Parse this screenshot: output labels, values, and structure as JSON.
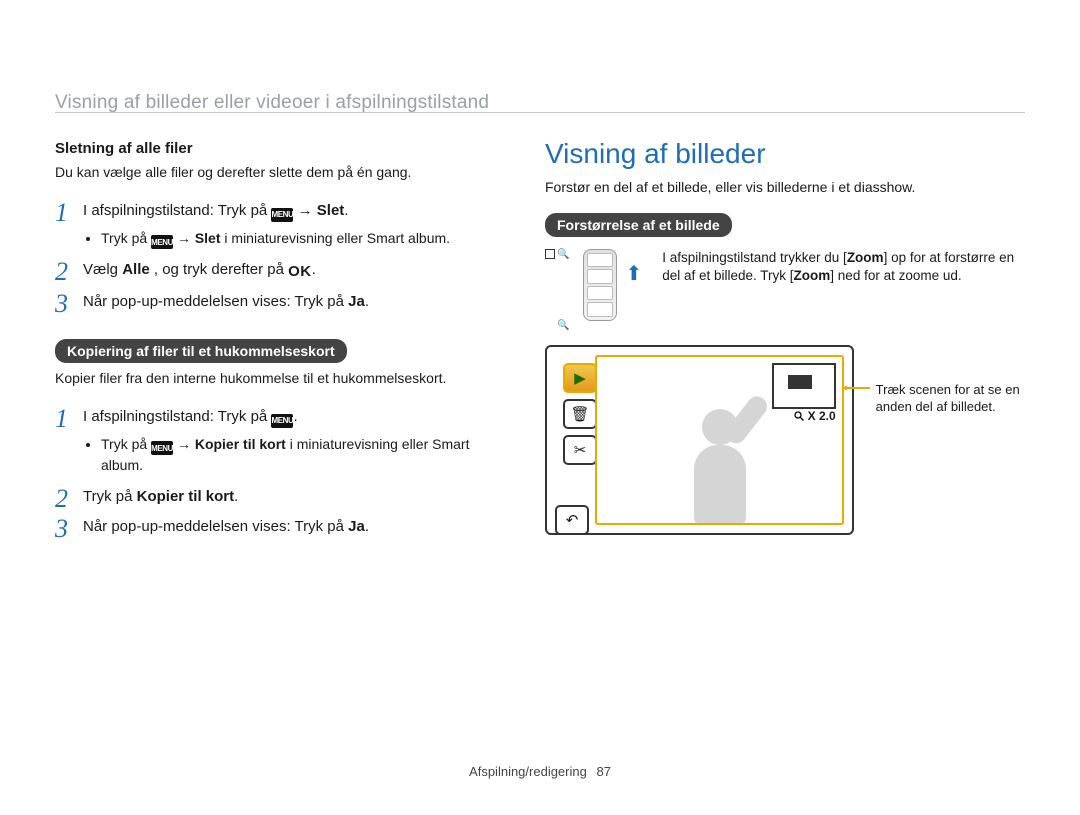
{
  "headerTitle": "Visning af billeder eller videoer i afspilningstilstand",
  "left": {
    "deleteHeading": "Sletning af alle filer",
    "deleteIntro": "Du kan vælge alle filer og derefter slette dem på én gang.",
    "deleteSteps": {
      "s1a": "I afspilningstilstand: Tryk på ",
      "s1b": " → ",
      "s1c": "Slet",
      "s1d": ".",
      "s1bullet_a": "Tryk på ",
      "s1bullet_b": " → ",
      "s1bullet_c": "Slet",
      "s1bullet_d": " i miniaturevisning eller Smart album.",
      "s2a": "Vælg ",
      "s2b": "Alle",
      "s2c": ", og tryk derefter på ",
      "s2ok": "OK",
      "s2d": ".",
      "s3a": "Når pop-up-meddelelsen vises: Tryk på ",
      "s3b": "Ja",
      "s3c": "."
    },
    "copyPill": "Kopiering af filer til et hukommelseskort",
    "copyIntro": "Kopier filer fra den interne hukommelse til et hukommelseskort.",
    "copySteps": {
      "s1a": "I afspilningstilstand: Tryk på ",
      "s1b": ".",
      "s1bullet_a": "Tryk på ",
      "s1bullet_b": " → ",
      "s1bullet_c": "Kopier til kort",
      "s1bullet_d": " i miniaturevisning eller Smart album.",
      "s2a": "Tryk på ",
      "s2b": "Kopier til kort",
      "s2c": ".",
      "s3a": "Når pop-up-meddelelsen vises: Tryk på ",
      "s3b": "Ja",
      "s3c": "."
    }
  },
  "right": {
    "title": "Visning af billeder",
    "intro": "Forstør en del af et billede, eller vis billederne i et diasshow.",
    "zoomPill": "Forstørrelse af et billede",
    "zoomDesc_a": "I afspilningstilstand trykker du [",
    "zoomDesc_b": "Zoom",
    "zoomDesc_c": "] op for at forstørre en del af et billede. Tryk [",
    "zoomDesc_d": "Zoom",
    "zoomDesc_e": "] ned for at zoome ud.",
    "zoomBadge": "X 2.0",
    "callout": "Træk scenen for at se en anden del af billedet."
  },
  "menuIcon": "MENU",
  "footer": {
    "section": "Afspilning/redigering",
    "page": "87"
  }
}
